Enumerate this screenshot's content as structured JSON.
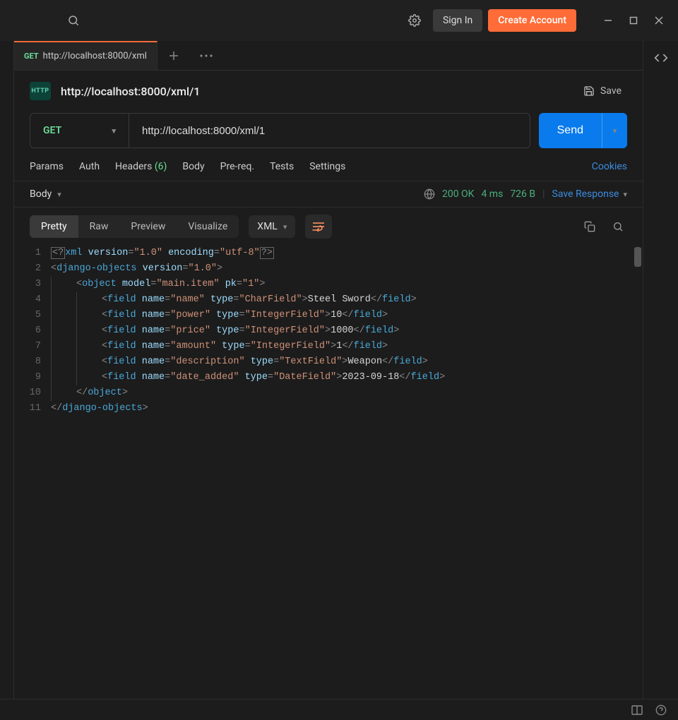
{
  "titlebar": {
    "signin": "Sign In",
    "create": "Create Account"
  },
  "tab": {
    "method": "GET",
    "label": "http://localhost:8000/xml"
  },
  "request": {
    "http_badge": "HTTP",
    "title": "http://localhost:8000/xml/1",
    "save": "Save",
    "method": "GET",
    "url": "http://localhost:8000/xml/1",
    "send": "Send"
  },
  "subtabs": {
    "params": "Params",
    "auth": "Auth",
    "headers": "Headers",
    "headers_count": "(6)",
    "body": "Body",
    "prereq": "Pre-req.",
    "tests": "Tests",
    "settings": "Settings",
    "cookies": "Cookies"
  },
  "response": {
    "body_label": "Body",
    "status": "200 OK",
    "time": "4 ms",
    "size": "726 B",
    "save_response": "Save Response"
  },
  "viewbar": {
    "pretty": "Pretty",
    "raw": "Raw",
    "preview": "Preview",
    "visualize": "Visualize",
    "format": "XML"
  },
  "code": {
    "xml_declaration": {
      "version": "1.0",
      "encoding": "utf-8"
    },
    "root": {
      "tag": "django-objects",
      "version": "1.0"
    },
    "object": {
      "model": "main.item",
      "pk": "1"
    },
    "fields": [
      {
        "name": "name",
        "type": "CharField",
        "value": "Steel Sword"
      },
      {
        "name": "power",
        "type": "IntegerField",
        "value": "10"
      },
      {
        "name": "price",
        "type": "IntegerField",
        "value": "1000"
      },
      {
        "name": "amount",
        "type": "IntegerField",
        "value": "1"
      },
      {
        "name": "description",
        "type": "TextField",
        "value": "Weapon"
      },
      {
        "name": "date_added",
        "type": "DateField",
        "value": "2023-09-18"
      }
    ],
    "line_count": 11
  }
}
